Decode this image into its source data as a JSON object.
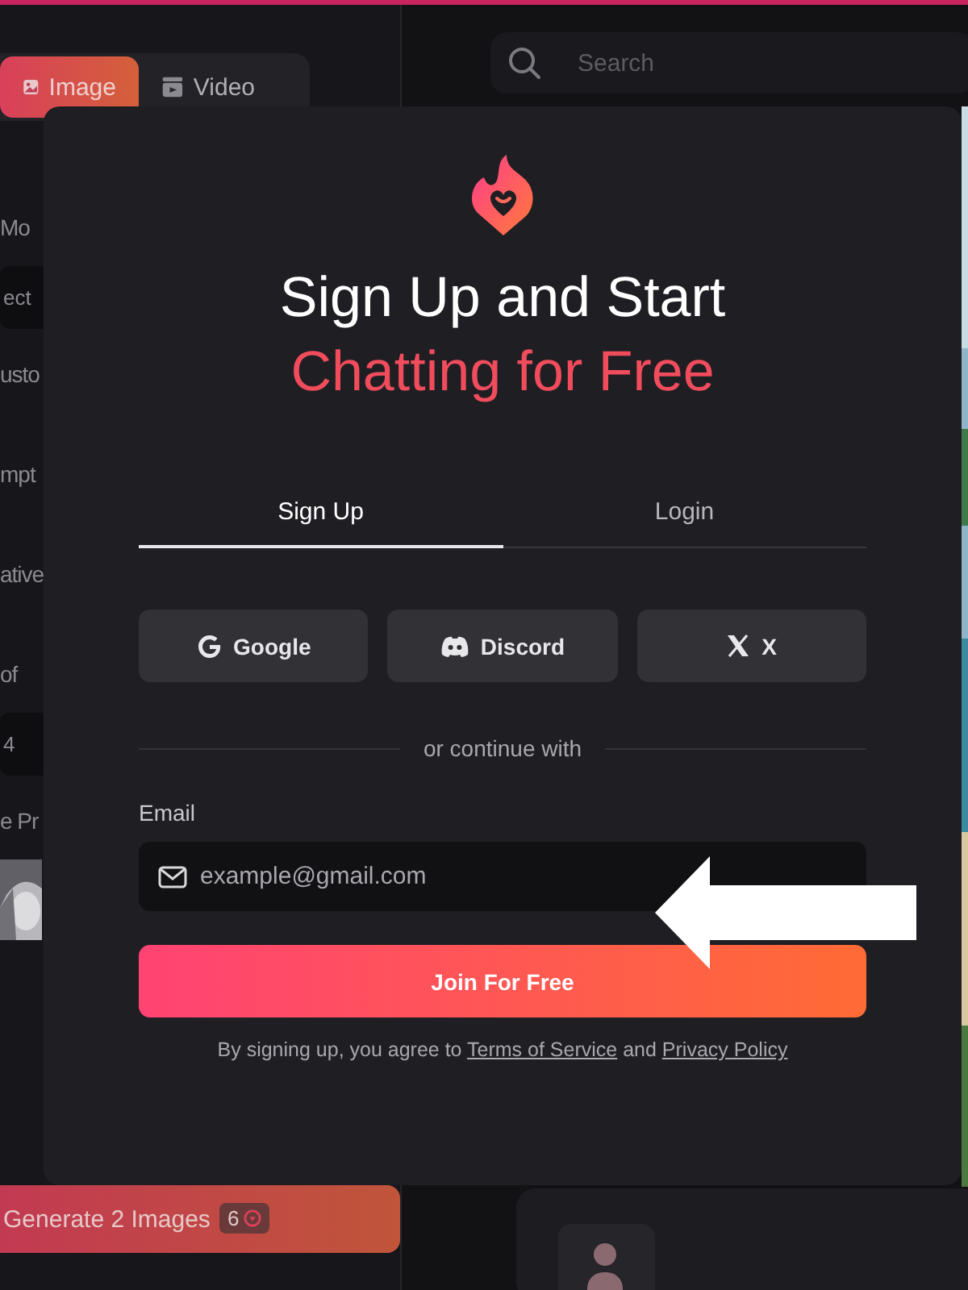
{
  "mode_tabs": [
    {
      "label": "Image",
      "selected": true
    },
    {
      "label": "Video",
      "selected": false
    }
  ],
  "search": {
    "placeholder": "Search"
  },
  "sidebar_fragments": [
    {
      "kind": "text",
      "text": "Mo"
    },
    {
      "kind": "field",
      "text": "ect"
    },
    {
      "kind": "text",
      "text": "usto"
    },
    {
      "kind": "text",
      "text": "mpt"
    },
    {
      "kind": "text",
      "text": "ative"
    },
    {
      "kind": "text",
      "text": "of"
    },
    {
      "kind": "field",
      "text": "4"
    },
    {
      "kind": "text",
      "text": "e Pr"
    },
    {
      "kind": "picture"
    }
  ],
  "generate_button": {
    "label": "Generate 2 Images",
    "cost": "6"
  },
  "modal": {
    "title": "Sign Up and Start",
    "title_accent": "Chatting for Free",
    "tabs": [
      {
        "label": "Sign Up",
        "selected": true
      },
      {
        "label": "Login",
        "selected": false
      }
    ],
    "social_buttons": [
      {
        "kind": "google",
        "label": "Google"
      },
      {
        "kind": "discord",
        "label": "Discord"
      },
      {
        "kind": "x",
        "label": "X"
      }
    ],
    "divider": "or continue with",
    "email": {
      "label": "Email",
      "placeholder": "example@gmail.com"
    },
    "submit": "Join For Free",
    "legal": {
      "text": "By signing up, you agree to",
      "terms": "Terms of Service",
      "and": "and",
      "privacy": "Privacy Policy"
    }
  }
}
